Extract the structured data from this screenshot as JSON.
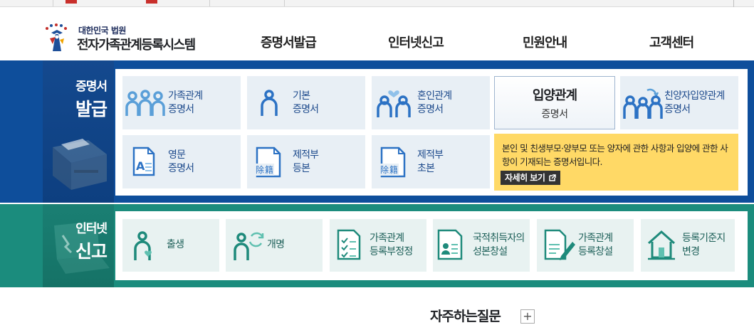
{
  "header": {
    "ministry": "대한민국 법원",
    "system_name": "전자가족관계등록시스템"
  },
  "gnb": [
    "증명서발급",
    "인터넷신고",
    "민원안내",
    "고객센터"
  ],
  "certificate": {
    "section_label_1": "증명서",
    "section_label_2": "발급",
    "cards": [
      {
        "line1": "가족관계",
        "line2": "증명서",
        "icon": "family-icon"
      },
      {
        "line1": "기본",
        "line2": "증명서",
        "icon": "person-icon"
      },
      {
        "line1": "혼인관계",
        "line2": "증명서",
        "icon": "marriage-icon"
      },
      {
        "line1": "입양관계",
        "line2": "증명서",
        "icon": "adoption-icon"
      },
      {
        "line1": "친양자입양관계",
        "line2": "증명서",
        "icon": "adopted-child-icon"
      },
      {
        "line1": "영문",
        "line2": "증명서",
        "icon": "english-document-icon"
      },
      {
        "line1": "제적부",
        "line2": "등본",
        "icon": "removed-register-icon"
      },
      {
        "line1": "제적부",
        "line2": "초본",
        "icon": "removed-register-icon"
      }
    ],
    "stamp_text": "除籍",
    "tooltip": {
      "text": "본인 및 친생부모·양부모 또는 양자에 관한 사항과 입양에 관한 사항이 기재되는 증명서입니다.",
      "more": "자세히 보기"
    }
  },
  "report": {
    "section_label_1": "인터넷",
    "section_label_2": "신고",
    "cards": [
      {
        "line1": "출생",
        "line2": "",
        "icon": "birth-icon"
      },
      {
        "line1": "개명",
        "line2": "",
        "icon": "rename-icon"
      },
      {
        "line1": "가족관계",
        "line2": "등록부정정",
        "icon": "checklist-icon"
      },
      {
        "line1": "국적취득자의",
        "line2": "성본창설",
        "icon": "id-card-icon"
      },
      {
        "line1": "가족관계",
        "line2": "등록창설",
        "icon": "document-pen-icon"
      },
      {
        "line1": "등록기준지",
        "line2": "변경",
        "icon": "house-icon"
      }
    ]
  },
  "faq": {
    "title": "자주하는질문",
    "plus": "+"
  },
  "colors": {
    "blue_band": "#0e4e9b",
    "green_band": "#1b8c7d",
    "tooltip": "#ffd966",
    "card_blue": "#e8eff5",
    "card_green": "#e8f2f1"
  }
}
